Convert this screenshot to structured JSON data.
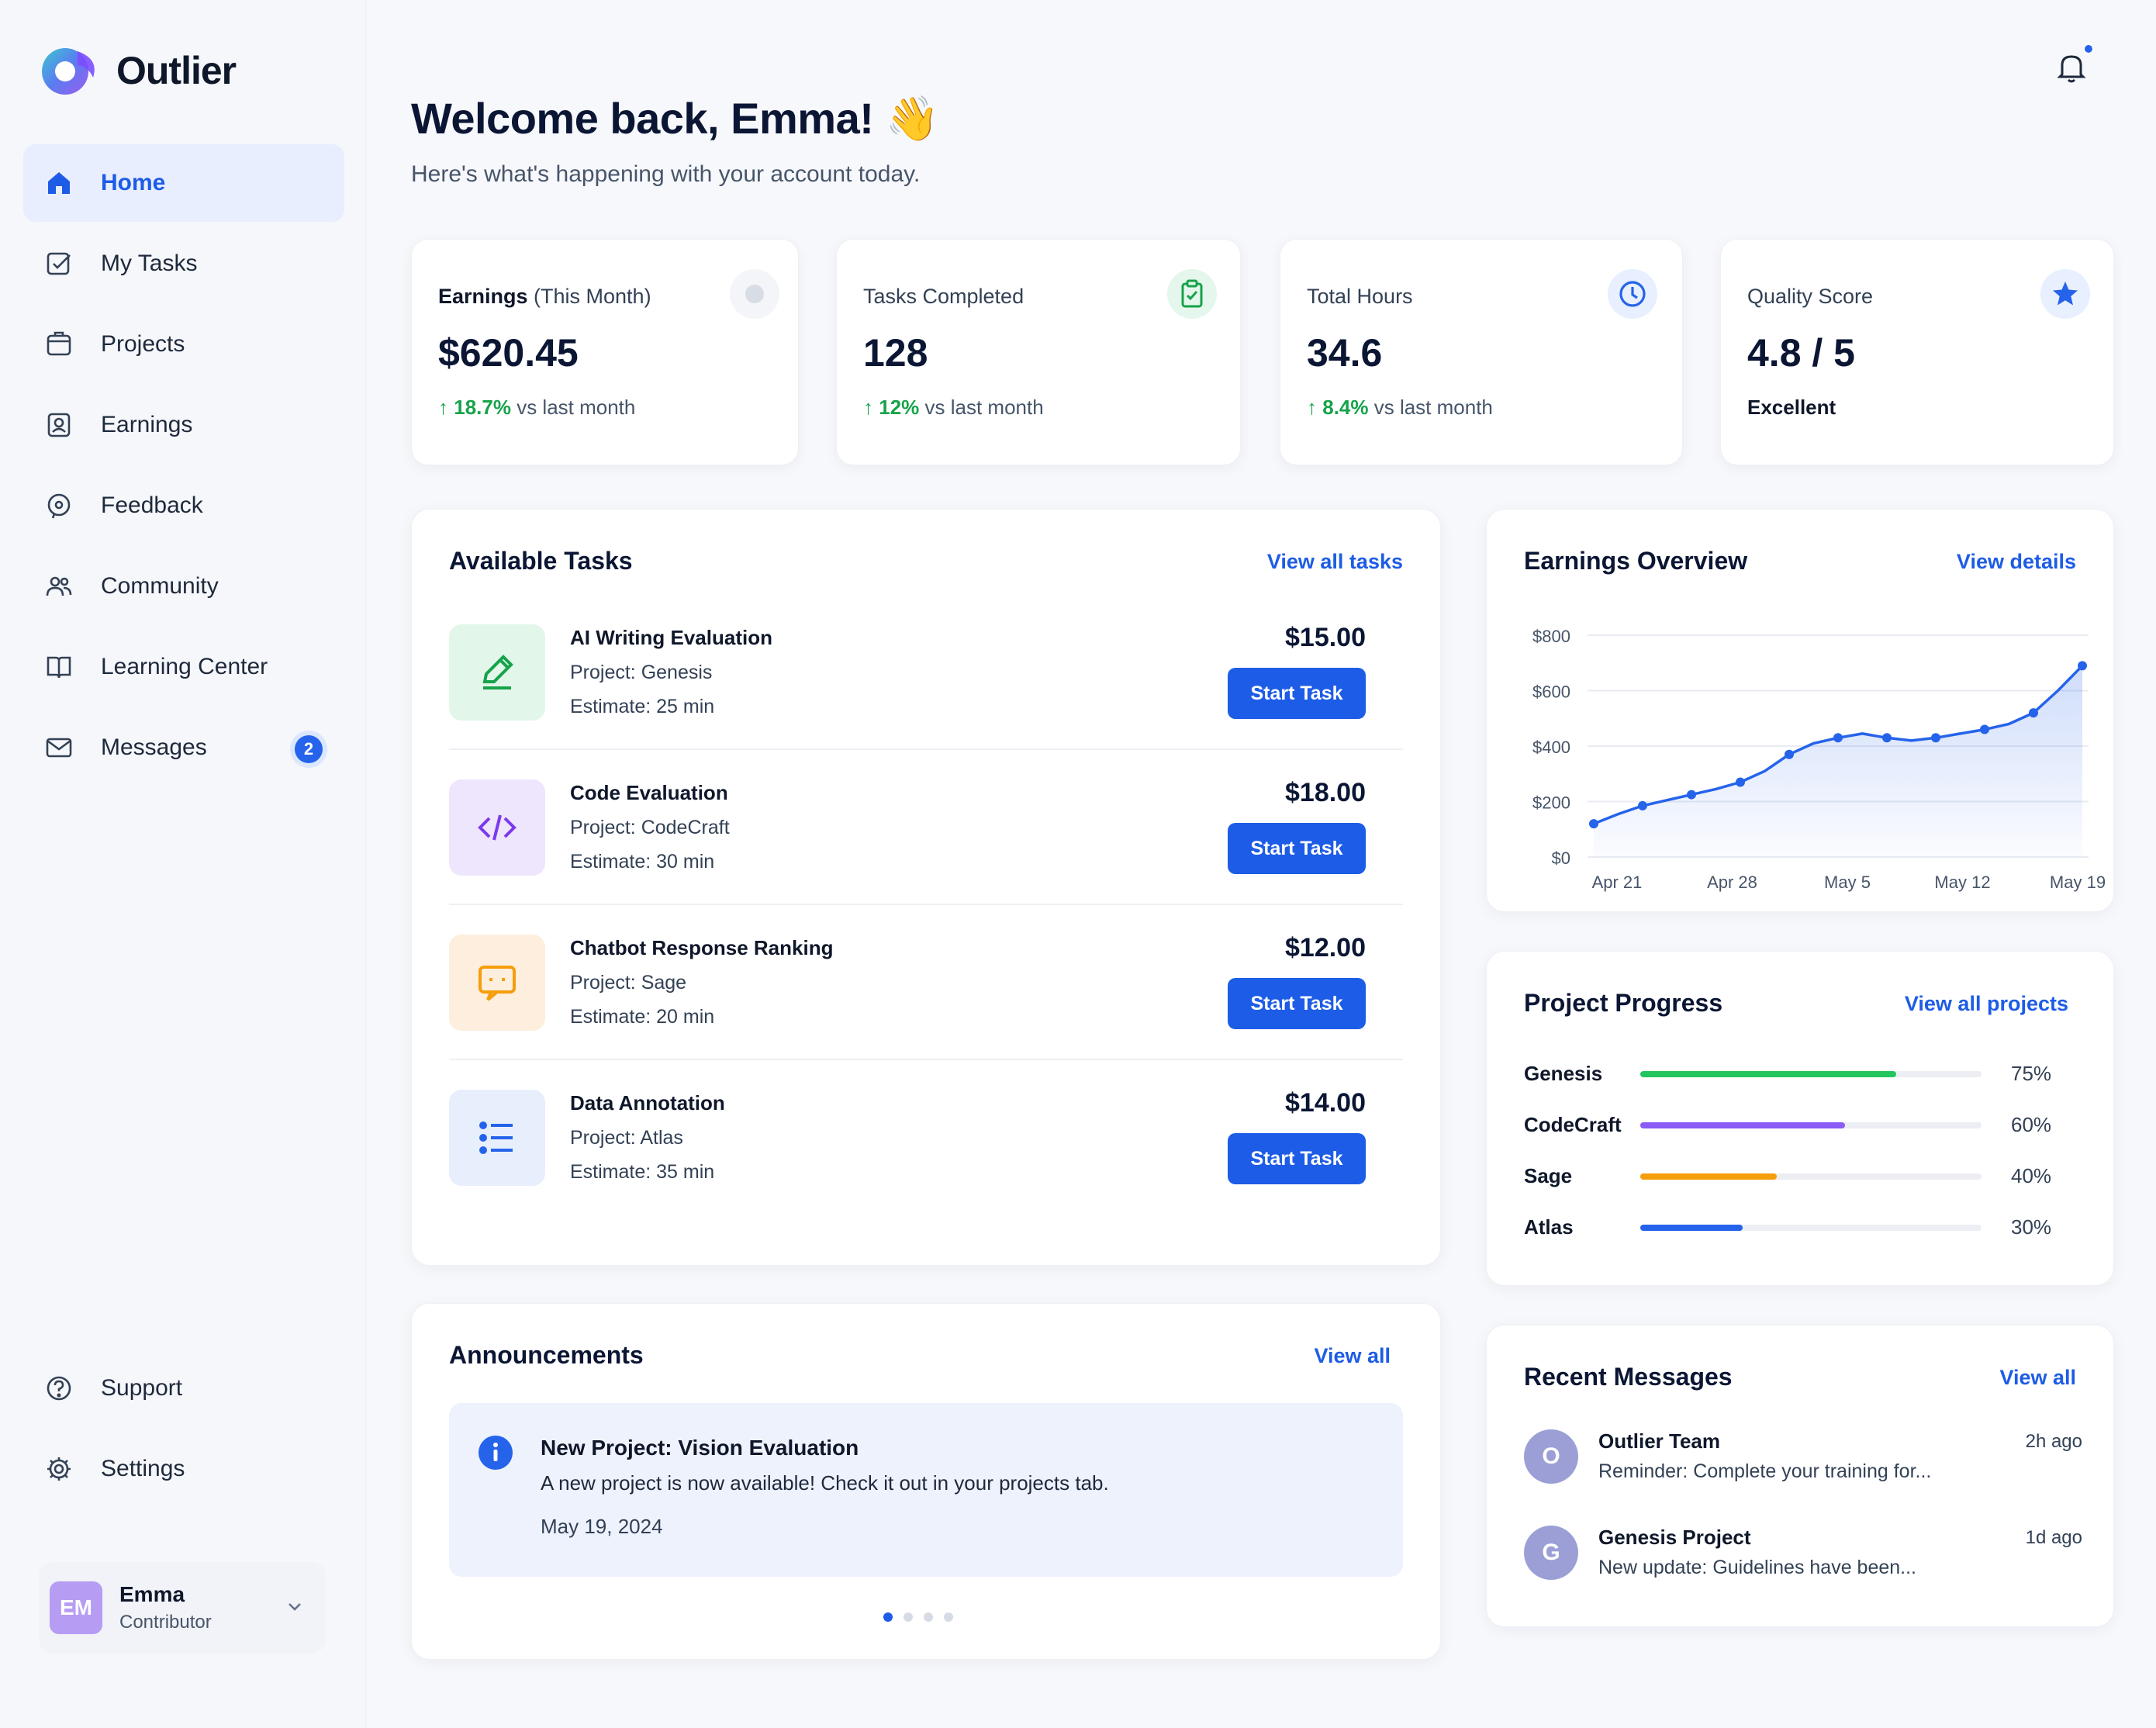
{
  "app": {
    "name": "Outlier"
  },
  "sidebar": {
    "items": [
      {
        "label": "Home",
        "icon": "home-icon",
        "active": true
      },
      {
        "label": "My Tasks",
        "icon": "tasks-icon"
      },
      {
        "label": "Projects",
        "icon": "folder-icon"
      },
      {
        "label": "Earnings",
        "icon": "earnings-icon"
      },
      {
        "label": "Feedback",
        "icon": "feedback-icon"
      },
      {
        "label": "Community",
        "icon": "community-icon"
      },
      {
        "label": "Learning Center",
        "icon": "book-icon"
      },
      {
        "label": "Messages",
        "icon": "mail-icon",
        "badge": "2"
      }
    ],
    "bottom_items": [
      {
        "label": "Support",
        "icon": "help-icon"
      },
      {
        "label": "Settings",
        "icon": "gear-icon"
      }
    ],
    "user": {
      "initials": "EM",
      "name": "Emma",
      "role": "Contributor"
    }
  },
  "header": {
    "title": "Welcome back, Emma! 👋",
    "subtitle": "Here's what's happening with your account today."
  },
  "stats": [
    {
      "label": "Earnings",
      "label_suffix": " (This Month)",
      "value": "$620.45",
      "delta": "18.7%",
      "delta_text": " vs last month",
      "icon": "dollar-icon"
    },
    {
      "label": "Tasks Completed",
      "value": "128",
      "delta": "12%",
      "delta_text": " vs last month",
      "icon": "clipboard-icon"
    },
    {
      "label": "Total Hours",
      "value": "34.6",
      "delta": "8.4%",
      "delta_text": " vs last month",
      "icon": "clock-icon"
    },
    {
      "label": "Quality Score",
      "value": "4.8 / 5",
      "note": "Excellent",
      "icon": "star-icon"
    }
  ],
  "tasks": {
    "title": "Available Tasks",
    "link": "View all tasks",
    "items": [
      {
        "title": "AI Writing Evaluation",
        "project": "Project: Genesis",
        "estimate": "Estimate: 25 min",
        "price": "$15.00",
        "button": "Start Task",
        "icon": "pencil-icon"
      },
      {
        "title": "Code Evaluation",
        "project": "Project: CodeCraft",
        "estimate": "Estimate: 30 min",
        "price": "$18.00",
        "button": "Start Task",
        "icon": "code-icon"
      },
      {
        "title": "Chatbot Response Ranking",
        "project": "Project: Sage",
        "estimate": "Estimate: 20 min",
        "price": "$12.00",
        "button": "Start Task",
        "icon": "chat-icon"
      },
      {
        "title": "Data Annotation",
        "project": "Project: Atlas",
        "estimate": "Estimate: 35 min",
        "price": "$14.00",
        "button": "Start Task",
        "icon": "list-icon"
      }
    ]
  },
  "announcements": {
    "title": "Announcements",
    "link": "View all",
    "item": {
      "title": "New Project: Vision Evaluation",
      "body": "A new project is now available! Check it out in your projects tab.",
      "date": "May 19, 2024"
    },
    "pager": {
      "count": 4,
      "active": 0
    }
  },
  "earnings_overview": {
    "title": "Earnings Overview",
    "link": "View details"
  },
  "chart_data": {
    "type": "area",
    "title": "Earnings Overview",
    "xlabel": "",
    "ylabel": "",
    "y_ticks": [
      "$0",
      "$200",
      "$400",
      "$600",
      "$800"
    ],
    "ylim": [
      0,
      800
    ],
    "x_ticks": [
      "Apr 21",
      "Apr 28",
      "May 5",
      "May 12",
      "May 19"
    ],
    "x": [
      "Apr 20",
      "Apr 22",
      "Apr 24",
      "Apr 25",
      "Apr 27",
      "Apr 28",
      "Apr 30",
      "May 1",
      "May 3",
      "May 4",
      "May 5",
      "May 6",
      "May 7",
      "May 9",
      "May 10",
      "May 12",
      "May 14",
      "May 16",
      "May 18",
      "May 19"
    ],
    "series": [
      {
        "values": [
          120,
          155,
          185,
          205,
          225,
          245,
          270,
          310,
          370,
          410,
          430,
          445,
          430,
          420,
          430,
          445,
          460,
          480,
          520,
          600,
          690
        ]
      }
    ],
    "grid": true,
    "color": "#2563eb"
  },
  "projects": {
    "title": "Project Progress",
    "link": "View all projects",
    "items": [
      {
        "name": "Genesis",
        "percent": 75,
        "label": "75%",
        "color": "#22c55e"
      },
      {
        "name": "CodeCraft",
        "percent": 60,
        "label": "60%",
        "color": "#8b5cf6"
      },
      {
        "name": "Sage",
        "percent": 40,
        "label": "40%",
        "color": "#f59e0b"
      },
      {
        "name": "Atlas",
        "percent": 30,
        "label": "30%",
        "color": "#2563eb"
      }
    ]
  },
  "messages": {
    "title": "Recent Messages",
    "link": "View all",
    "items": [
      {
        "initial": "O",
        "from": "Outlier Team",
        "preview": "Reminder: Complete your training for...",
        "time": "2h ago"
      },
      {
        "initial": "G",
        "from": "Genesis Project",
        "preview": "New update: Guidelines have been...",
        "time": "1d ago"
      }
    ]
  }
}
